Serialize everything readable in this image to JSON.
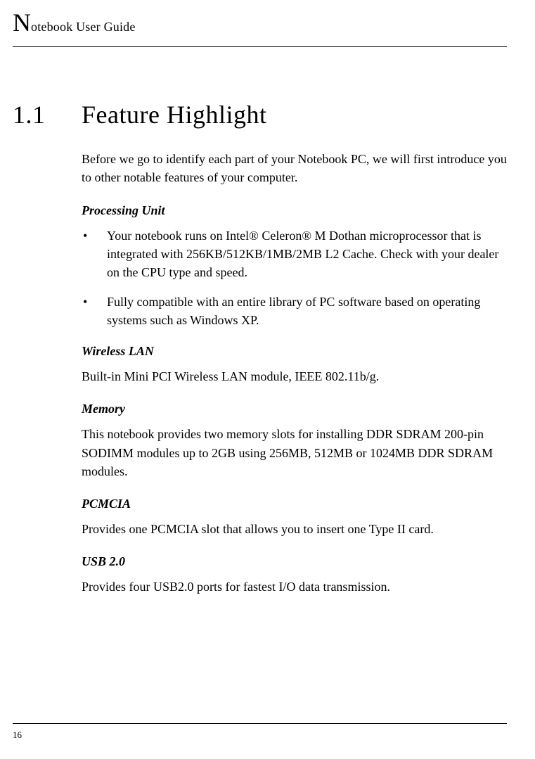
{
  "header": {
    "firstLetter": "N",
    "rest": "otebook User Guide"
  },
  "section": {
    "number": "1.1",
    "title": "Feature Highlight",
    "intro": "Before we go to identify each part of your Notebook PC, we will first introduce you to other notable features of your computer."
  },
  "processingUnit": {
    "heading": "Processing Unit",
    "items": [
      "Your notebook runs on Intel® Celeron® M Dothan microprocessor that is integrated with 256KB/512KB/1MB/2MB L2 Cache. Check with your dealer on the CPU type and speed.",
      "Fully compatible with an entire library of PC software based on operating systems such as Windows XP."
    ]
  },
  "wirelessLan": {
    "heading": "Wireless LAN",
    "text": "Built-in Mini PCI Wireless LAN module, IEEE 802.11b/g."
  },
  "memory": {
    "heading": "Memory",
    "text": "This notebook provides two memory slots for installing DDR SDRAM 200-pin SODIMM modules up to 2GB using 256MB, 512MB or 1024MB DDR SDRAM modules."
  },
  "pcmcia": {
    "heading": "PCMCIA",
    "text": "Provides one PCMCIA slot that allows you to insert one Type II card."
  },
  "usb": {
    "heading": "USB 2.0",
    "text": "Provides four USB2.0 ports for fastest I/O data transmission."
  },
  "pageNumber": "16"
}
